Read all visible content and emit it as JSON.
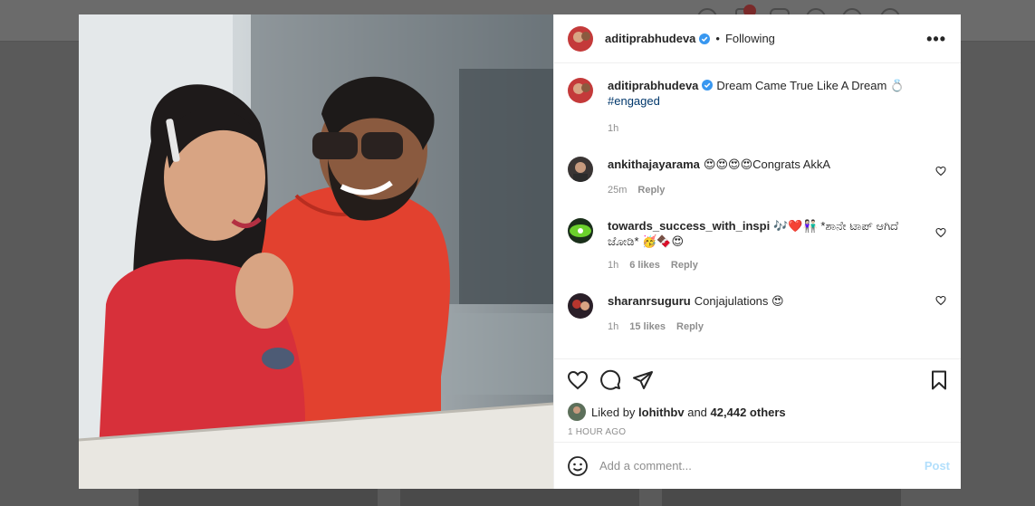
{
  "post": {
    "username": "aditiprabhudeva",
    "follow_state": "Following",
    "more_label": "•••",
    "caption": {
      "username": "aditiprabhudeva",
      "text": "Dream Came True Like A Dream 💍",
      "hashtag": "#engaged",
      "time": "1h"
    },
    "comments": [
      {
        "username": "ankithajayarama",
        "text": "😍😍😍😍Congrats AkkA",
        "time": "25m",
        "likes": "",
        "reply": "Reply"
      },
      {
        "username": "towards_success_with_inspi",
        "text": "🎶❤️👫🏻 *ಶಾನೇ ಟಾಪ್ ಆಗಿದೆ ಜೋಡಿ* 🥳🍫😍",
        "time": "1h",
        "likes": "6 likes",
        "reply": "Reply"
      },
      {
        "username": "sharanrsuguru",
        "text": "Conjajulations 😍",
        "time": "1h",
        "likes": "15 likes",
        "reply": "Reply"
      }
    ],
    "liked_by_prefix": "Liked by",
    "liked_by_user": "lohithbv",
    "liked_by_and": "and",
    "liked_by_others": "42,442 others",
    "timestamp": "1 HOUR AGO",
    "comment_placeholder": "Add a comment...",
    "post_button": "Post"
  },
  "icons": {
    "like": "heart-icon",
    "comment": "comment-icon",
    "share": "send-icon",
    "save": "bookmark-icon",
    "emoji": "smiley-icon",
    "verified": "verified-badge-icon"
  },
  "colors": {
    "verified": "#3897f0",
    "link": "#00376b",
    "post_disabled": "#b2dffc"
  }
}
